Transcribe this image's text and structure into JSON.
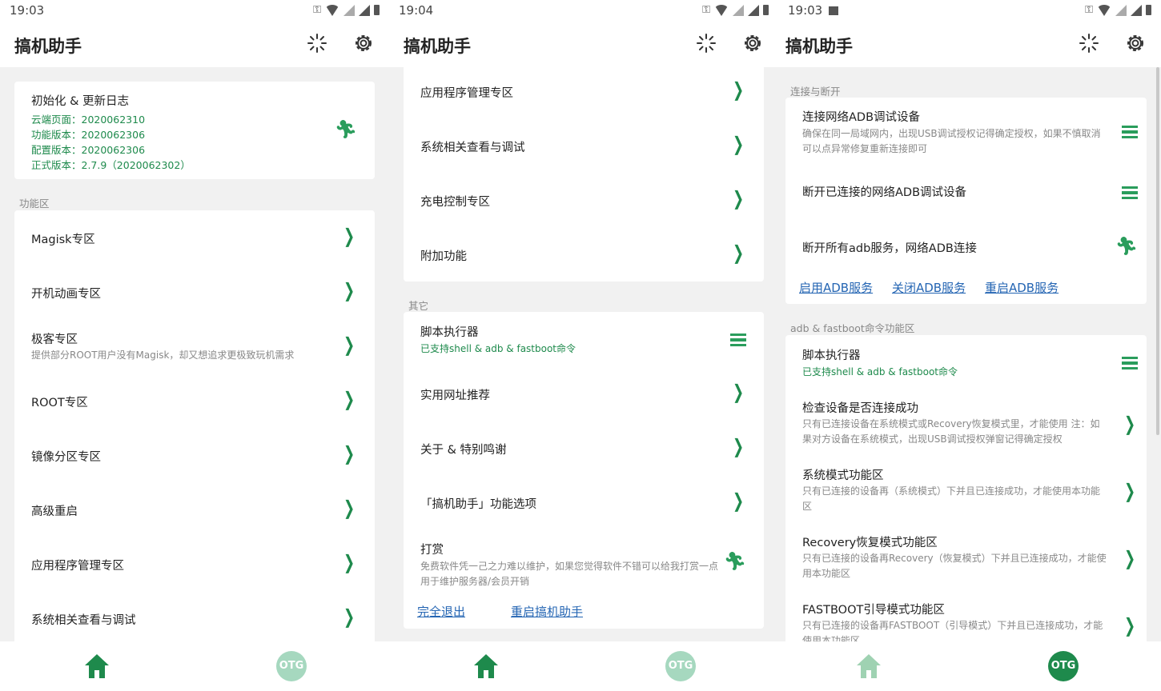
{
  "colors": {
    "accent": "#1e8a4c",
    "link": "#2465b3",
    "home_active": "#1e8a4c",
    "home_inactive": "#9fd2b2",
    "otg_inactive": "#a6d8bf",
    "otg_active": "#1e8a4c"
  },
  "app_title": "搞机助手",
  "screen1": {
    "time": "19:03",
    "init_card": {
      "title": "初始化 & 更新日志",
      "lines": [
        "云端页面：2020062310",
        "功能版本：2020062306",
        "配置版本：2020062306",
        "正式版本：2.7.9（2020062302）"
      ]
    },
    "section_label": "功能区",
    "items": [
      {
        "label": "Magisk专区",
        "desc": ""
      },
      {
        "label": "开机动画专区",
        "desc": ""
      },
      {
        "label": "极客专区",
        "desc": "提供部分ROOT用户没有Magisk，却又想追求更极致玩机需求"
      },
      {
        "label": "ROOT专区",
        "desc": ""
      },
      {
        "label": "镜像分区专区",
        "desc": ""
      },
      {
        "label": "高级重启",
        "desc": ""
      },
      {
        "label": "应用程序管理专区",
        "desc": ""
      },
      {
        "label": "系统相关查看与调试",
        "desc": ""
      }
    ],
    "otg": "OTG"
  },
  "screen2": {
    "time": "19:04",
    "items_top": [
      "应用程序管理专区",
      "系统相关查看与调试",
      "充电控制专区",
      "附加功能"
    ],
    "section_label": "其它",
    "script": {
      "label": "脚本执行器",
      "desc": "已支持shell & adb & fastboot命令"
    },
    "items_other": [
      "实用网址推荐",
      "关于 & 特别鸣谢",
      "「搞机助手」功能选项"
    ],
    "donate": {
      "label": "打赏",
      "desc": "免费软件凭一己之力难以维护，如果您觉得软件不错可以给我打赏一点用于维护服务器/会员开销"
    },
    "links": [
      "完全退出",
      "重启搞机助手"
    ],
    "otg": "OTG"
  },
  "screen3": {
    "time": "19:03",
    "section1": "连接与断开",
    "conn_items": [
      {
        "label": "连接网络ADB调试设备",
        "desc": "确保在同一局域网内，出现USB调试授权记得确定授权，如果不慎取消可以点异常修复重新连接即可"
      },
      {
        "label": "断开已连接的网络ADB调试设备",
        "desc": ""
      },
      {
        "label": "断开所有adb服务，网络ADB连接",
        "desc": ""
      }
    ],
    "adb_links": [
      "启用ADB服务",
      "关闭ADB服务",
      "重启ADB服务"
    ],
    "section2": "adb & fastboot命令功能区",
    "cmd_items": [
      {
        "label": "脚本执行器",
        "desc": "已支持shell & adb & fastboot命令"
      },
      {
        "label": "检查设备是否连接成功",
        "desc": "只有已连接设备在系统模式或Recovery恢复模式里，才能使用 注：如果对方设备在系统模式，出现USB调试授权弹窗记得确定授权"
      },
      {
        "label": "系统模式功能区",
        "desc": "只有已连接的设备再（系统模式）下并且已连接成功，才能使用本功能区"
      },
      {
        "label": "Recovery恢复模式功能区",
        "desc": "只有已连接的设备再Recovery（恢复模式）下并且已连接成功，才能使用本功能区"
      },
      {
        "label": "FASTBOOT引导模式功能区",
        "desc": "只有已连接的设备再FASTBOOT（引导模式）下并且已连接成功，才能使用本功能区"
      }
    ],
    "otg": "OTG"
  }
}
